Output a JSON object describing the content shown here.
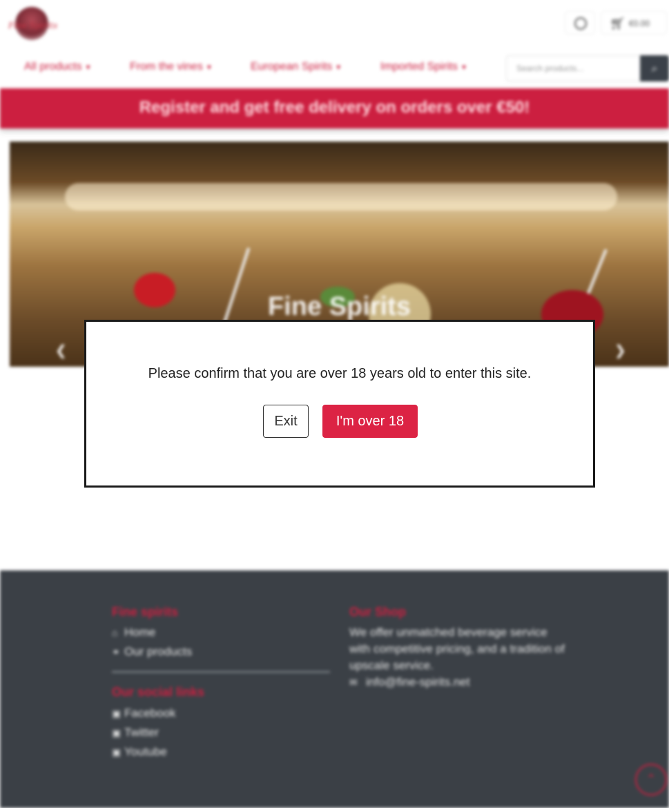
{
  "header": {
    "logo_text": "Fine Spirits",
    "cart_total": "€0.00"
  },
  "nav": {
    "items": [
      {
        "label": "All products"
      },
      {
        "label": "From the vines"
      },
      {
        "label": "European Spirits"
      },
      {
        "label": "Imported Spirits"
      }
    ],
    "search_placeholder": "Search products..."
  },
  "banner": {
    "text": "Register and get free delivery on orders over €50!"
  },
  "hero": {
    "title": "Fine Spirits"
  },
  "age_gate": {
    "message": "Please confirm that you are over 18 years old to enter this site.",
    "exit_label": "Exit",
    "confirm_label": "I'm over 18"
  },
  "footer": {
    "brand_heading": "Fine spirits",
    "links": [
      {
        "label": "Home",
        "icon": "home-icon"
      },
      {
        "label": "Our products",
        "icon": "link-icon"
      }
    ],
    "social_heading": "Our social links",
    "social": [
      {
        "label": "Facebook",
        "icon": "facebook-icon"
      },
      {
        "label": "Twitter",
        "icon": "twitter-icon"
      },
      {
        "label": "Youtube",
        "icon": "youtube-icon"
      }
    ],
    "shop_heading": "Our Shop",
    "about": "We offer unmatched beverage service with competitive pricing, and a tradition of upscale service.",
    "email": "info@fine-spirits.net"
  },
  "colors": {
    "brand_red": "#cc1f40",
    "footer_bg": "#3b4046",
    "confirm_button": "#dc2344"
  }
}
